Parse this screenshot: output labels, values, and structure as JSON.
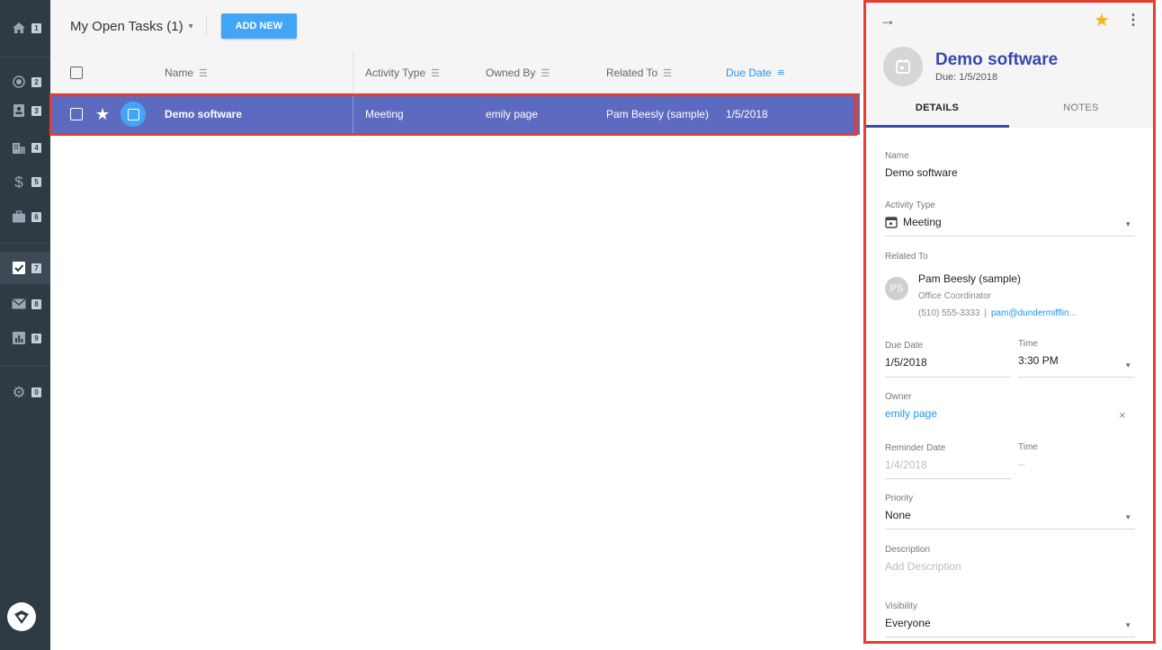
{
  "sidebar": {
    "items": [
      {
        "icon": "home-icon",
        "key": "1"
      },
      {
        "icon": "radar-icon",
        "key": "2"
      },
      {
        "icon": "contact-card-icon",
        "key": "3"
      },
      {
        "icon": "building-icon",
        "key": "4"
      },
      {
        "icon": "dollar-icon",
        "key": "5"
      },
      {
        "icon": "briefcase-icon",
        "key": "6"
      },
      {
        "icon": "checkbox-icon",
        "key": "7"
      },
      {
        "icon": "mail-icon",
        "key": "8"
      },
      {
        "icon": "bar-chart-icon",
        "key": "9"
      },
      {
        "icon": "gear-icon",
        "key": "0"
      }
    ],
    "active_key": "7"
  },
  "toolbar": {
    "view_title": "My Open Tasks (1)",
    "add_label": "ADD NEW"
  },
  "table": {
    "columns": [
      "Name",
      "Activity Type",
      "Owned By",
      "Related To",
      "Due Date"
    ],
    "sorted_column": "Due Date",
    "rows": [
      {
        "name": "Demo software",
        "activity_type": "Meeting",
        "owned_by": "emily page",
        "related_to": "Pam Beesly (sample)",
        "due_date": "1/5/2018",
        "starred": true
      }
    ]
  },
  "panel": {
    "title": "Demo software",
    "subtitle": "Due: 1/5/2018",
    "tabs": [
      "DETAILS",
      "NOTES"
    ],
    "fields": {
      "name_label": "Name",
      "name_value": "Demo software",
      "activity_label": "Activity Type",
      "activity_value": "Meeting",
      "related_label": "Related To",
      "related_name": "Pam Beesly (sample)",
      "related_initials": "PS",
      "related_title": "Office Coordinator",
      "related_phone": "(510) 555-3333",
      "related_sep": "|",
      "related_email": "pam@dundermifflin...",
      "due_label": "Due Date",
      "due_value": "1/5/2018",
      "time_label": "Time",
      "time_value": "3:30 PM",
      "owner_label": "Owner",
      "owner_value": "emily page",
      "owner_clear": "×",
      "reminder_label": "Reminder Date",
      "reminder_value": "1/4/2018",
      "reminder_time_label": "Time",
      "reminder_time_value": "--",
      "priority_label": "Priority",
      "priority_value": "None",
      "description_label": "Description",
      "description_placeholder": "Add Description",
      "visibility_label": "Visibility",
      "visibility_value": "Everyone"
    }
  },
  "colors": {
    "sidebar_bg": "#2f3b44",
    "accent_blue": "#42a5f5",
    "selected_row": "#5c6bc0",
    "title_indigo": "#3949ab",
    "star_gold": "#f6b21b",
    "highlight_red": "#e53e2e"
  }
}
